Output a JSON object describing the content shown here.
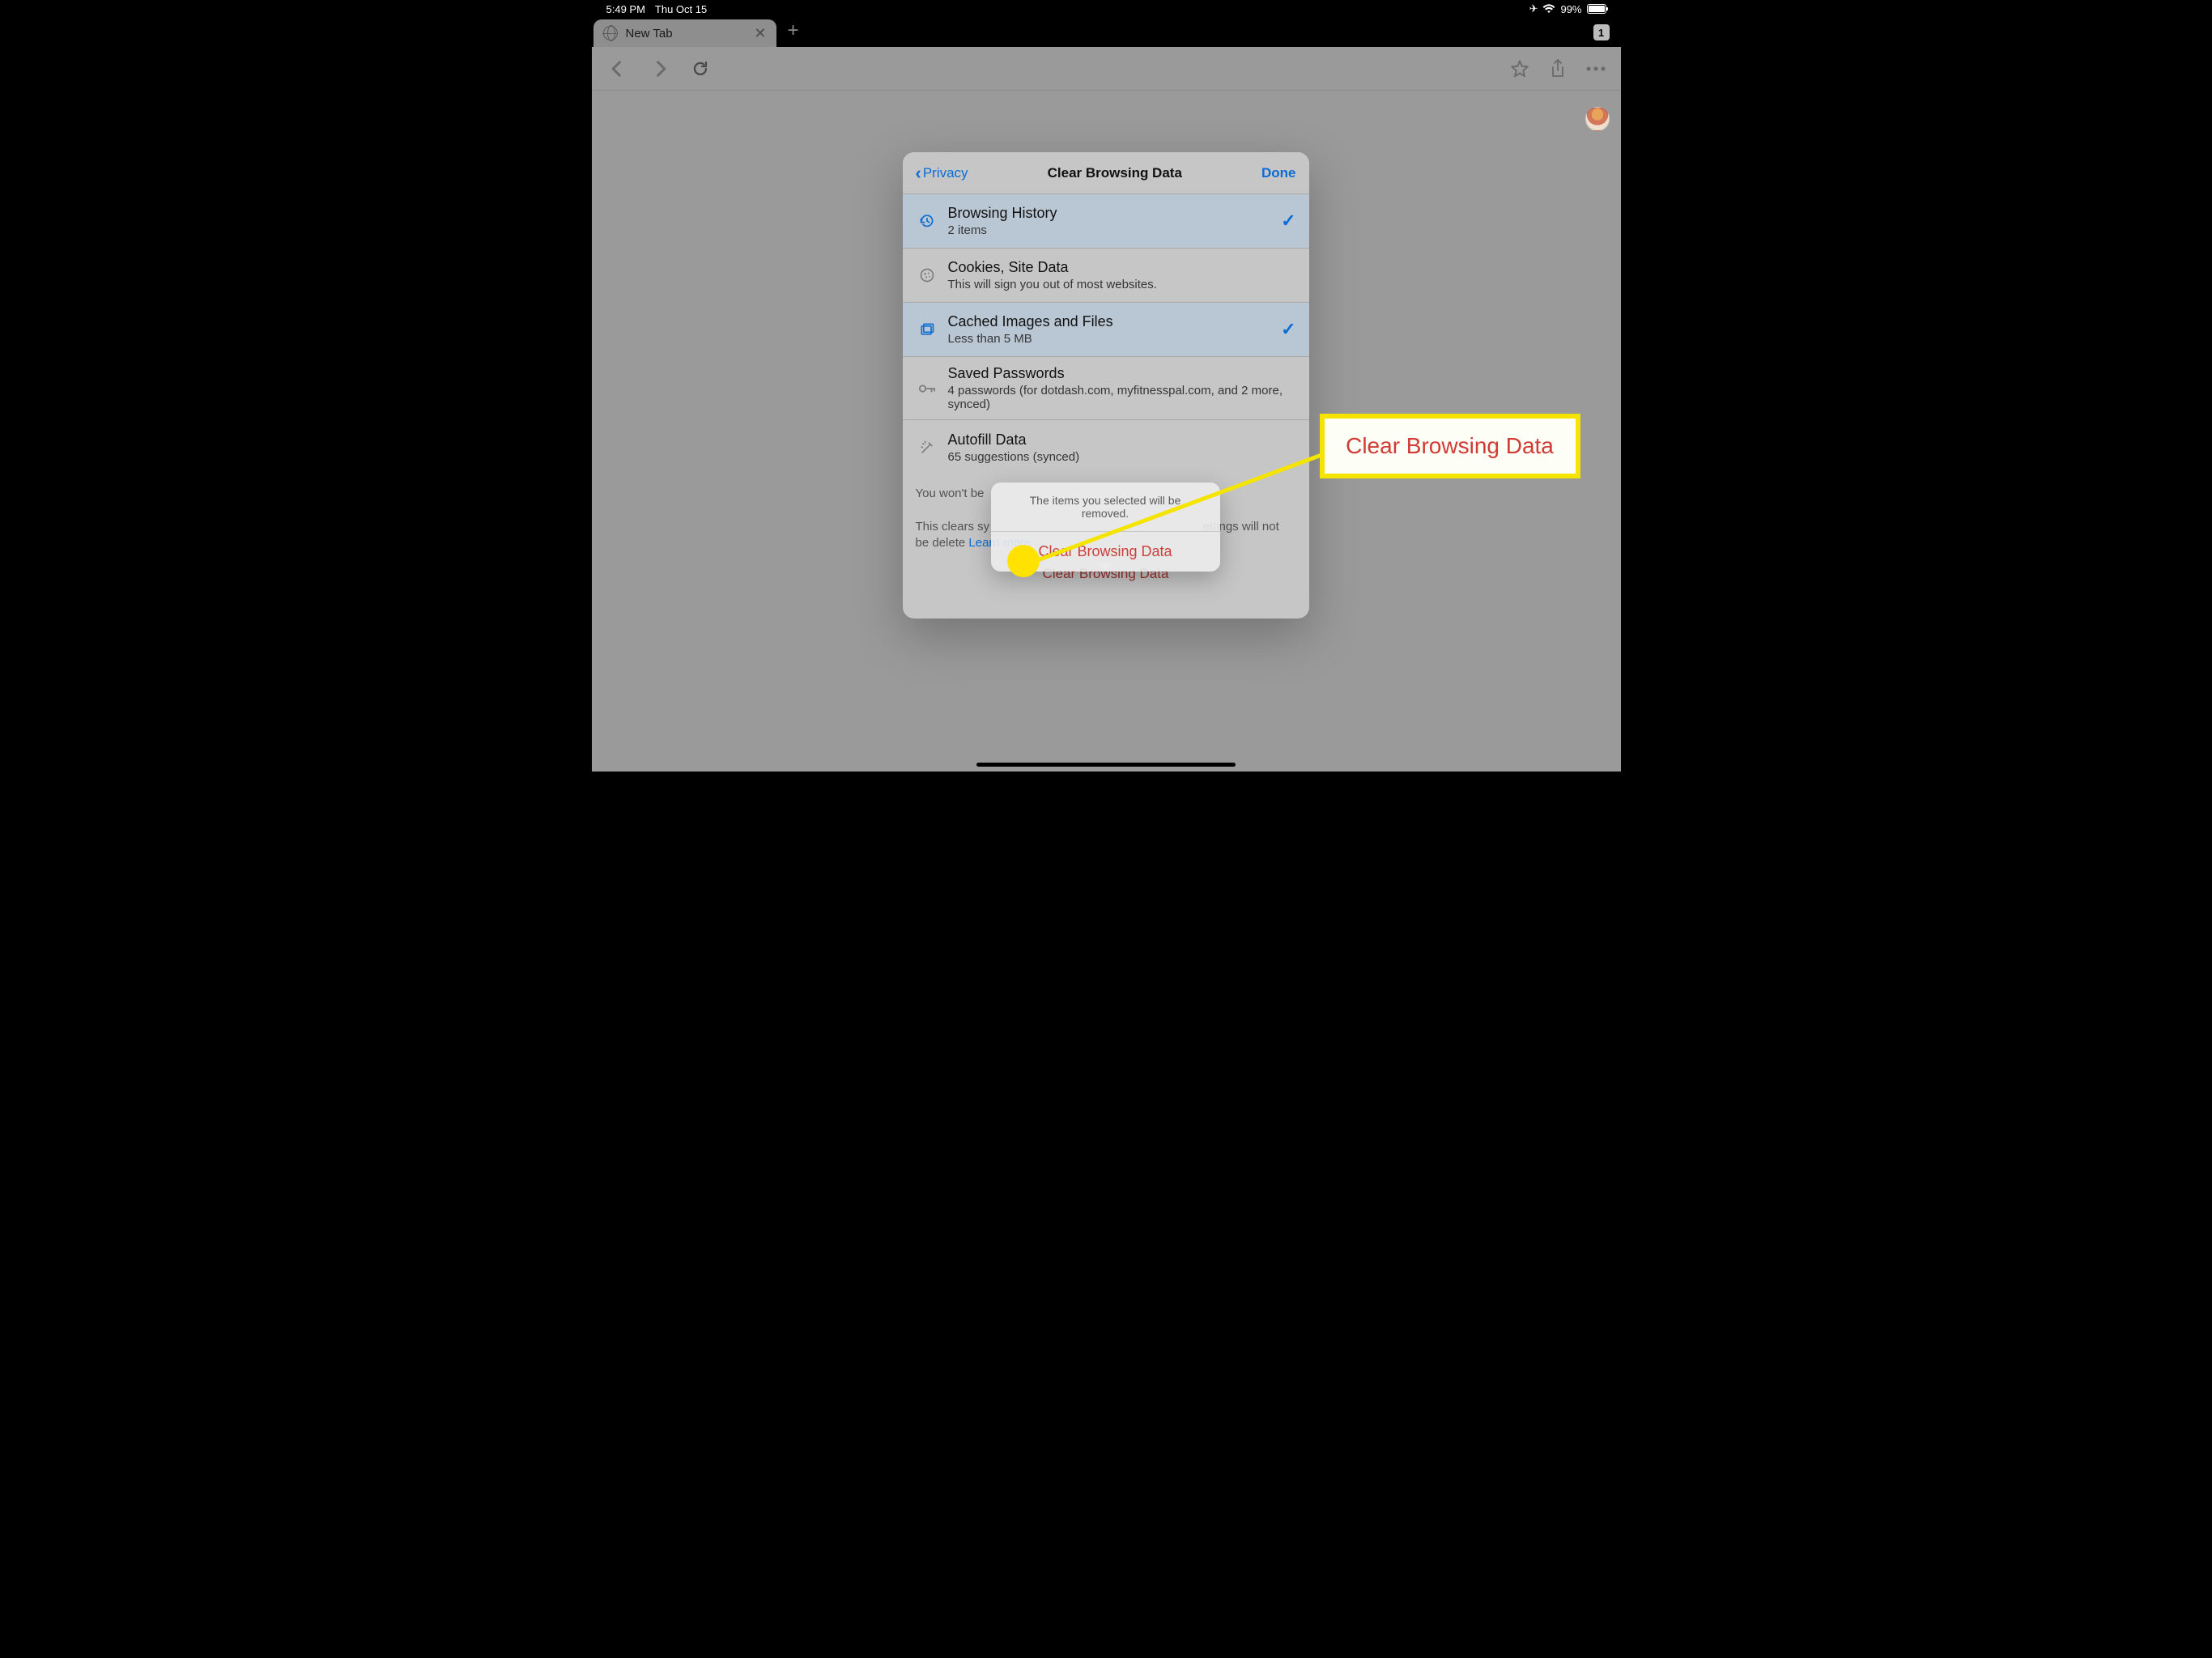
{
  "status": {
    "time": "5:49 PM",
    "date": "Thu Oct 15",
    "battery_pct": "99%"
  },
  "tab": {
    "title": "New Tab",
    "count": "1"
  },
  "sheet": {
    "back_label": "Privacy",
    "title": "Clear Browsing Data",
    "done_label": "Done",
    "options": [
      {
        "title": "Browsing History",
        "sub": "2 items",
        "selected": true
      },
      {
        "title": "Cookies, Site Data",
        "sub": "This will sign you out of most websites.",
        "selected": false
      },
      {
        "title": "Cached Images and Files",
        "sub": "Less than 5 MB",
        "selected": true
      },
      {
        "title": "Saved Passwords",
        "sub": "4 passwords (for dotdash.com, myfitnesspal.com, and 2 more, synced)",
        "selected": false
      },
      {
        "title": "Autofill Data",
        "sub": "65 suggestions (synced)",
        "selected": false
      }
    ],
    "footer_line1": "You won't be",
    "footer_line2a": "This clears sy",
    "footer_line2b": "ettings will not be delete",
    "learn_more": "Learn more",
    "clear_btn": "Clear Browsing Data"
  },
  "popover": {
    "message": "The items you selected will be removed.",
    "button": "Clear Browsing Data"
  },
  "callout": {
    "text": "Clear Browsing Data"
  }
}
